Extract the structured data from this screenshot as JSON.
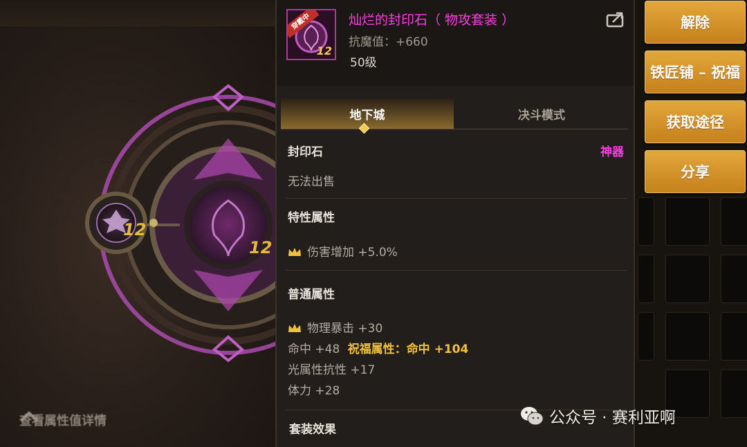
{
  "item": {
    "name": "灿烂的封印石（ 物攻套装 ）",
    "equipped_tag": "穿戴中",
    "level_badge": "12",
    "resist": "抗魔值：+660",
    "level": "50级",
    "name_color": "#ff3fe0"
  },
  "tabs": [
    {
      "label": "地下城",
      "active": true
    },
    {
      "label": "决斗模式",
      "active": false
    }
  ],
  "category": {
    "type": "封印石",
    "rarity": "神器",
    "rarity_color": "#ff3fe0"
  },
  "trade": "无法出售",
  "special": {
    "title": "特性属性",
    "stats": [
      "伤害增加 +5.0%"
    ]
  },
  "normal": {
    "title": "普通属性",
    "stats": [
      "物理暴击 +30",
      "命中 +48",
      "光属性抗性 +17",
      "体力 +28"
    ],
    "blessing_label": "祝福属性：",
    "blessing_value": "命中 +104"
  },
  "set": {
    "title": "套装效果"
  },
  "side_buttons": [
    "解除",
    "铁匠铺 – 祝福",
    "获取途径",
    "分享"
  ],
  "left": {
    "detail_link": "查看属性值详情",
    "left_badge": "12",
    "center_badge": "12"
  },
  "watermark": "公众号 · 赛利亚啊",
  "icons": [
    "share-icon",
    "crown-icon",
    "chevron-up-icon",
    "wechat-icon"
  ]
}
